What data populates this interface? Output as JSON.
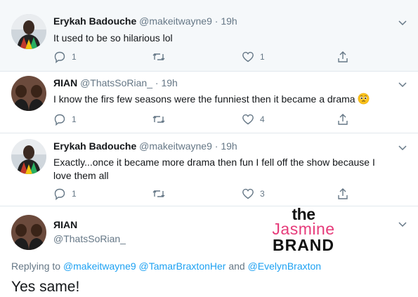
{
  "tweets": [
    {
      "name": "Erykah Badouche",
      "handle": "@makeitwayne9",
      "separator": "·",
      "time": "19h",
      "text": "It used to be so hilarious lol",
      "replies": "1",
      "retweets": "",
      "likes": "1"
    },
    {
      "name": "ЯIAN",
      "handle": "@ThatsSoRian_",
      "separator": "·",
      "time": "19h",
      "text": "I know the firs few seasons were the funniest then it became a drama",
      "emoji": "pleading-face-emoji",
      "replies": "1",
      "retweets": "",
      "likes": "4"
    },
    {
      "name": "Erykah Badouche",
      "handle": "@makeitwayne9",
      "separator": "·",
      "time": "19h",
      "text_line1": "Exactly...once it became more drama then fun I fell off the show because I",
      "text_line2": "love them all",
      "replies": "1",
      "retweets": "",
      "likes": "3"
    }
  ],
  "main_tweet": {
    "name": "ЯIAN",
    "handle": "@ThatsSoRian_",
    "replying_prefix": "Replying to",
    "mention1": "@makeitwayne9",
    "mention2": "@TamarBraxtonHer",
    "and_word": "and",
    "mention3": "@EvelynBraxton",
    "text": "Yes same!"
  },
  "watermark": {
    "line1": "the",
    "line2": "Jasmine",
    "line3": "BRAND"
  },
  "colors": {
    "link": "#1da1f2",
    "secondary": "#657786",
    "watermark_pink": "#e63b7a"
  }
}
